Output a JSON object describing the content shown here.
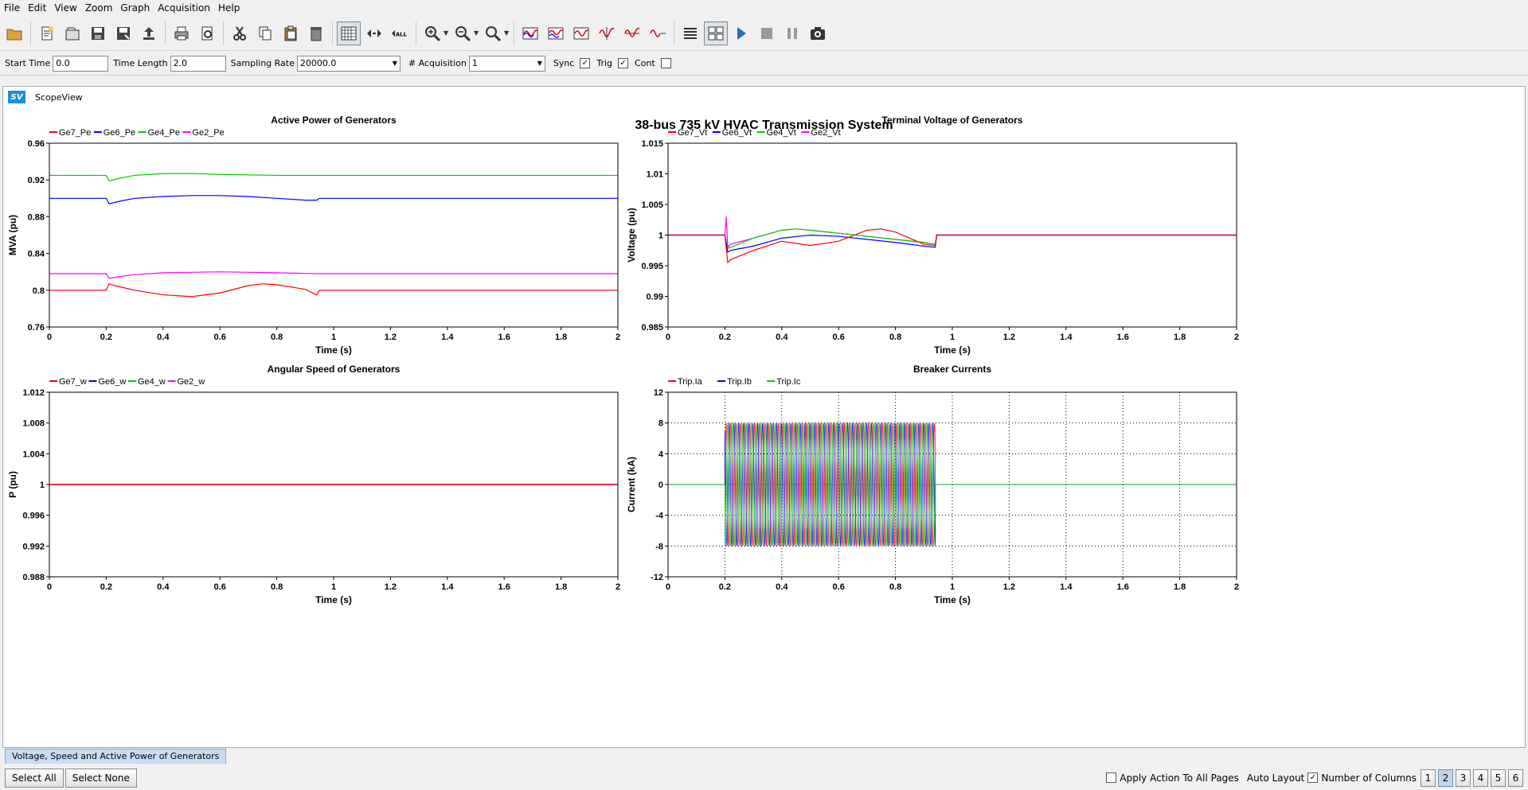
{
  "menu": [
    "File",
    "Edit",
    "View",
    "Zoom",
    "Graph",
    "Acquisition",
    "Help"
  ],
  "toolbar": {
    "icons": [
      "open-folder-icon",
      "new-page-icon",
      "open-icon",
      "save-icon",
      "save-as-icon",
      "export-icon",
      "print-icon",
      "print-preview-icon",
      "cut-icon",
      "copy-icon",
      "paste-icon",
      "delete-icon",
      "grid-icon",
      "zoom-fit-icon",
      "zoom-all-icon",
      "zoom-in-icon",
      "zoom-out-icon",
      "zoom-xy-icon",
      "signal-ops-1-icon",
      "signal-ops-2-icon",
      "signal-ops-3-icon",
      "signal-ops-4-icon",
      "signal-ops-5-icon",
      "signal-ops-6-icon",
      "list-icon",
      "layout-icon",
      "play-icon",
      "stop-icon",
      "pause-icon",
      "camera-icon"
    ],
    "zoom_all_label": "ALL"
  },
  "params": {
    "start_time_label": "Start Time",
    "start_time": "0.0",
    "time_length_label": "Time Length",
    "time_length": "2.0",
    "sampling_rate_label": "Sampling Rate",
    "sampling_rate": "20000.0",
    "acquisition_label": "# Acquisition",
    "acquisition": "1",
    "sync_label": "Sync",
    "trig_label": "Trig",
    "cont_label": "Cont",
    "sync": true,
    "trig": true,
    "cont": false
  },
  "scopeview": {
    "logo": "SV",
    "title": "ScopeView",
    "main_title": "38-bus 735 kV HVAC Transmission System"
  },
  "colors": {
    "red": "#ff0000",
    "blue": "#0000ff",
    "green": "#00cc00",
    "magenta": "#ff00ff"
  },
  "chart_data": [
    {
      "type": "line",
      "title": "Active Power of Generators",
      "xlabel": "Time (s)",
      "ylabel": "MVA (pu)",
      "xlim": [
        0,
        2
      ],
      "ylim": [
        0.76,
        0.96
      ],
      "xticks": [
        "0",
        "0.2",
        "0.4",
        "0.6",
        "0.8",
        "1",
        "1.2",
        "1.4",
        "1.6",
        "1.8",
        "2"
      ],
      "yticks": [
        "0.76",
        "0.8",
        "0.84",
        "0.88",
        "0.92",
        "0.96"
      ],
      "grid": false,
      "legend": "top-left",
      "series": [
        {
          "name": "Ge7_Pe",
          "color": "#ff0000",
          "x": [
            0,
            0.2,
            0.21,
            0.23,
            0.3,
            0.4,
            0.5,
            0.6,
            0.7,
            0.75,
            0.8,
            0.9,
            0.94,
            0.95,
            2
          ],
          "y": [
            0.8,
            0.8,
            0.807,
            0.805,
            0.8,
            0.795,
            0.793,
            0.797,
            0.805,
            0.807,
            0.806,
            0.801,
            0.795,
            0.8,
            0.8
          ]
        },
        {
          "name": "Ge6_Pe",
          "color": "#0000ff",
          "x": [
            0,
            0.2,
            0.21,
            0.25,
            0.3,
            0.4,
            0.5,
            0.6,
            0.7,
            0.8,
            0.9,
            0.94,
            0.95,
            2
          ],
          "y": [
            0.9,
            0.9,
            0.894,
            0.897,
            0.9,
            0.902,
            0.903,
            0.903,
            0.902,
            0.9,
            0.898,
            0.898,
            0.9,
            0.9
          ]
        },
        {
          "name": "Ge4_Pe",
          "color": "#00cc00",
          "x": [
            0,
            0.2,
            0.21,
            0.25,
            0.3,
            0.4,
            0.5,
            0.6,
            0.8,
            1,
            2
          ],
          "y": [
            0.925,
            0.925,
            0.919,
            0.922,
            0.925,
            0.927,
            0.927,
            0.926,
            0.925,
            0.925,
            0.925
          ]
        },
        {
          "name": "Ge2_Pe",
          "color": "#ff00ff",
          "x": [
            0,
            0.2,
            0.21,
            0.25,
            0.3,
            0.4,
            0.6,
            0.8,
            0.95,
            2
          ],
          "y": [
            0.818,
            0.818,
            0.813,
            0.815,
            0.817,
            0.819,
            0.82,
            0.819,
            0.818,
            0.818
          ]
        }
      ]
    },
    {
      "type": "line",
      "title": "Terminal Voltage of Generators",
      "xlabel": "Time (s)",
      "ylabel": "Voltage (pu)",
      "xlim": [
        0,
        2
      ],
      "ylim": [
        0.985,
        1.015
      ],
      "xticks": [
        "0",
        "0.2",
        "0.4",
        "0.6",
        "0.8",
        "1",
        "1.2",
        "1.4",
        "1.6",
        "1.8",
        "2"
      ],
      "yticks": [
        "0.985",
        "0.99",
        "0.995",
        "1",
        "1.005",
        "1.01",
        "1.015"
      ],
      "grid": false,
      "legend": "top-left",
      "series": [
        {
          "name": "Ge7_Vt",
          "color": "#ff0000",
          "x": [
            0,
            0.2,
            0.21,
            0.22,
            0.3,
            0.4,
            0.5,
            0.6,
            0.7,
            0.75,
            0.8,
            0.9,
            0.94,
            0.945,
            2
          ],
          "y": [
            1.0,
            1.0,
            0.9955,
            0.996,
            0.9975,
            0.999,
            0.9983,
            0.999,
            1.0008,
            1.001,
            1.0005,
            0.9985,
            0.9983,
            1.0,
            1.0
          ]
        },
        {
          "name": "Ge6_Vt",
          "color": "#0000ff",
          "x": [
            0,
            0.2,
            0.21,
            0.22,
            0.3,
            0.4,
            0.5,
            0.6,
            0.7,
            0.8,
            0.9,
            0.94,
            0.945,
            2
          ],
          "y": [
            1.0,
            1.0,
            0.9972,
            0.9975,
            0.9982,
            0.9995,
            1.0,
            0.9998,
            0.9993,
            0.9988,
            0.9982,
            0.998,
            1.0,
            1.0
          ]
        },
        {
          "name": "Ge4_Vt",
          "color": "#00cc00",
          "x": [
            0,
            0.2,
            0.21,
            0.22,
            0.3,
            0.4,
            0.45,
            0.5,
            0.6,
            0.7,
            0.8,
            0.9,
            0.94,
            0.945,
            2
          ],
          "y": [
            1.0,
            1.0,
            0.9978,
            0.998,
            0.9995,
            1.0008,
            1.001,
            1.0008,
            1.0003,
            0.9998,
            0.9993,
            0.9988,
            0.9985,
            1.0,
            1.0
          ]
        },
        {
          "name": "Ge2_Vt",
          "color": "#ff00ff",
          "x": [
            0,
            0.2,
            0.205,
            0.21,
            0.22,
            0.3,
            0.4,
            0.45,
            0.5,
            0.6,
            0.7,
            0.8,
            0.9,
            0.94,
            0.945,
            2
          ],
          "y": [
            1.0,
            1.0,
            1.003,
            0.998,
            0.9985,
            0.9995,
            1.0008,
            1.001,
            1.0008,
            1.0003,
            0.9998,
            0.9993,
            0.9988,
            0.9985,
            1.0,
            1.0
          ]
        }
      ]
    },
    {
      "type": "line",
      "title": "Angular Speed of Generators",
      "xlabel": "Time (s)",
      "ylabel": "P (pu)",
      "xlim": [
        0,
        2
      ],
      "ylim": [
        0.988,
        1.012
      ],
      "xticks": [
        "0",
        "0.2",
        "0.4",
        "0.6",
        "0.8",
        "1",
        "1.2",
        "1.4",
        "1.6",
        "1.8",
        "2"
      ],
      "yticks": [
        "0.988",
        "0.992",
        "0.996",
        "1",
        "1.004",
        "1.008",
        "1.012"
      ],
      "grid": false,
      "legend": "top-left",
      "series": [
        {
          "name": "Ge7_w",
          "color": "#ff0000",
          "x": [
            0,
            2
          ],
          "y": [
            1.0,
            1.0
          ]
        },
        {
          "name": "Ge6_w",
          "color": "#0000ff",
          "x": [
            0,
            2
          ],
          "y": [
            1.0,
            1.0
          ]
        },
        {
          "name": "Ge4_w",
          "color": "#00cc00",
          "x": [
            0,
            2
          ],
          "y": [
            1.0,
            1.0
          ]
        },
        {
          "name": "Ge2_w",
          "color": "#ff00ff",
          "x": [
            0,
            2
          ],
          "y": [
            1.0,
            1.0
          ]
        }
      ]
    },
    {
      "type": "line",
      "title": "Breaker Currents",
      "xlabel": "Time (s)",
      "ylabel": "Current (kA)",
      "xlim": [
        0,
        2
      ],
      "ylim": [
        -12,
        12
      ],
      "xticks": [
        "0",
        "0.2",
        "0.4",
        "0.6",
        "0.8",
        "1",
        "1.2",
        "1.4",
        "1.6",
        "1.8",
        "2"
      ],
      "yticks": [
        "-12",
        "-8",
        "-4",
        "0",
        "4",
        "8",
        "12"
      ],
      "grid": true,
      "legend": "top-left",
      "oscillation": {
        "start": 0.2,
        "end": 0.94,
        "amplitude": 8,
        "frequency_hz": 60
      },
      "series": [
        {
          "name": "Trip.Ia",
          "color": "#ff0000",
          "phase_deg": 0
        },
        {
          "name": "Trip.Ib",
          "color": "#0000ff",
          "phase_deg": 120
        },
        {
          "name": "Trip.Ic",
          "color": "#00cc00",
          "phase_deg": 240
        }
      ]
    }
  ],
  "page_tab": "Voltage, Speed and Active Power of Generators",
  "status": {
    "select_all": "Select All",
    "select_none": "Select None",
    "apply_all": "Apply Action To All Pages",
    "apply_all_checked": false,
    "auto_layout": "Auto Layout",
    "auto_layout_checked": true,
    "num_columns": "Number of Columns",
    "columns": [
      "1",
      "2",
      "3",
      "4",
      "5",
      "6"
    ],
    "active_column": "2"
  }
}
